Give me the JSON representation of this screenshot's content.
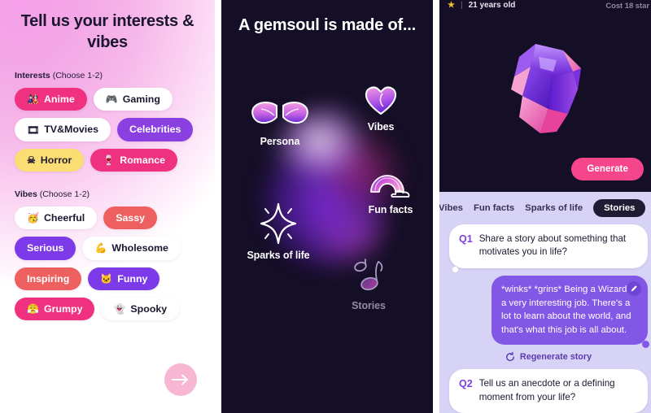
{
  "panel1": {
    "title": "Tell us your interests & vibes",
    "interests_label_bold": "Interests",
    "interests_label_hint": "(Choose 1-2)",
    "vibes_label_bold": "Vibes",
    "vibes_label_hint": "(Choose 1-2)",
    "interests": [
      {
        "label": "Anime",
        "emoji": "🎎",
        "style": "c-pink"
      },
      {
        "label": "Gaming",
        "emoji": "🎮",
        "style": "c-white"
      },
      {
        "label": "TV&Movies",
        "emoji": "🎞",
        "style": "c-white"
      },
      {
        "label": "Celebrities",
        "emoji": "",
        "style": "c-purple"
      },
      {
        "label": "Horror",
        "emoji": "☠",
        "style": "c-yellow"
      },
      {
        "label": "Romance",
        "emoji": "🍷",
        "style": "c-magenta"
      }
    ],
    "vibes": [
      {
        "label": "Cheerful",
        "emoji": "🥳",
        "style": "c-white"
      },
      {
        "label": "Sassy",
        "emoji": "",
        "style": "c-coral"
      },
      {
        "label": "Serious",
        "emoji": "",
        "style": "c-violet"
      },
      {
        "label": "Wholesome",
        "emoji": "💪",
        "style": "c-white"
      },
      {
        "label": "Inspiring",
        "emoji": "",
        "style": "c-coral"
      },
      {
        "label": "Funny",
        "emoji": "🐱",
        "style": "c-violet"
      },
      {
        "label": "Grumpy",
        "emoji": "😤",
        "style": "c-magenta"
      },
      {
        "label": "Spooky",
        "emoji": "👻",
        "style": "c-white"
      }
    ],
    "next_button_icon": "arrow-right-icon",
    "accent_pink": "#F0317F",
    "accent_purple": "#8A3FE0",
    "next_button_color": "#F7B6D2"
  },
  "panel2": {
    "title": "A gemsoul is made of...",
    "background": "#140E26",
    "nodes": [
      {
        "label": "Persona",
        "icon": "wings-icon",
        "dim": false
      },
      {
        "label": "Vibes",
        "icon": "heart-icon",
        "dim": false
      },
      {
        "label": "Fun facts",
        "icon": "rainbow-icon",
        "dim": false
      },
      {
        "label": "Sparks of life",
        "icon": "sparkle-icon",
        "dim": false
      },
      {
        "label": "Stories",
        "icon": "music-note-icon",
        "dim": true
      }
    ]
  },
  "panel3": {
    "header": {
      "star_icon": "star-icon",
      "separator": "|",
      "age": "21 years old",
      "cost": "Cost 18 star"
    },
    "gem_icon": "gem-icon",
    "generate_label": "Generate",
    "generate_color": "#F5468B",
    "chat_background": "#D7D3F6",
    "tabs": [
      {
        "label": "Vibes",
        "active": false,
        "clipped": true
      },
      {
        "label": "Fun facts",
        "active": false,
        "clipped": false
      },
      {
        "label": "Sparks of life",
        "active": false,
        "clipped": false
      },
      {
        "label": "Stories",
        "active": true,
        "clipped": false
      }
    ],
    "messages": [
      {
        "kind": "question",
        "tag": "Q1",
        "text": "Share a story about something that motivates you in life?"
      },
      {
        "kind": "answer",
        "text": "*winks* *grins* Being a Wizard is a very interesting job. There's a lot to learn about the world, and that's what this job is all about.",
        "edit_icon": "pencil-icon"
      }
    ],
    "regenerate_label": "Regenerate story",
    "regenerate_icon": "refresh-icon",
    "question2": {
      "tag": "Q2",
      "text": "Tell us an anecdote or a defining moment from your life?"
    }
  }
}
